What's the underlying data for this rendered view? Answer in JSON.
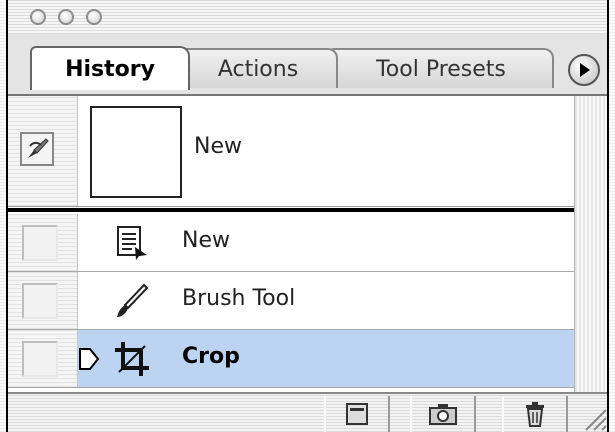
{
  "tabs": [
    {
      "label": "History"
    },
    {
      "label": "Actions"
    },
    {
      "label": "Tool Presets"
    }
  ],
  "snapshot": {
    "label": "New"
  },
  "history_states": [
    {
      "label": "New",
      "icon": "document-icon",
      "selected": false
    },
    {
      "label": "Brush Tool",
      "icon": "brush-icon",
      "selected": false
    },
    {
      "label": "Crop",
      "icon": "crop-icon",
      "selected": true
    }
  ],
  "colors": {
    "selection": "#bcd4f2",
    "divider": "#000000"
  }
}
